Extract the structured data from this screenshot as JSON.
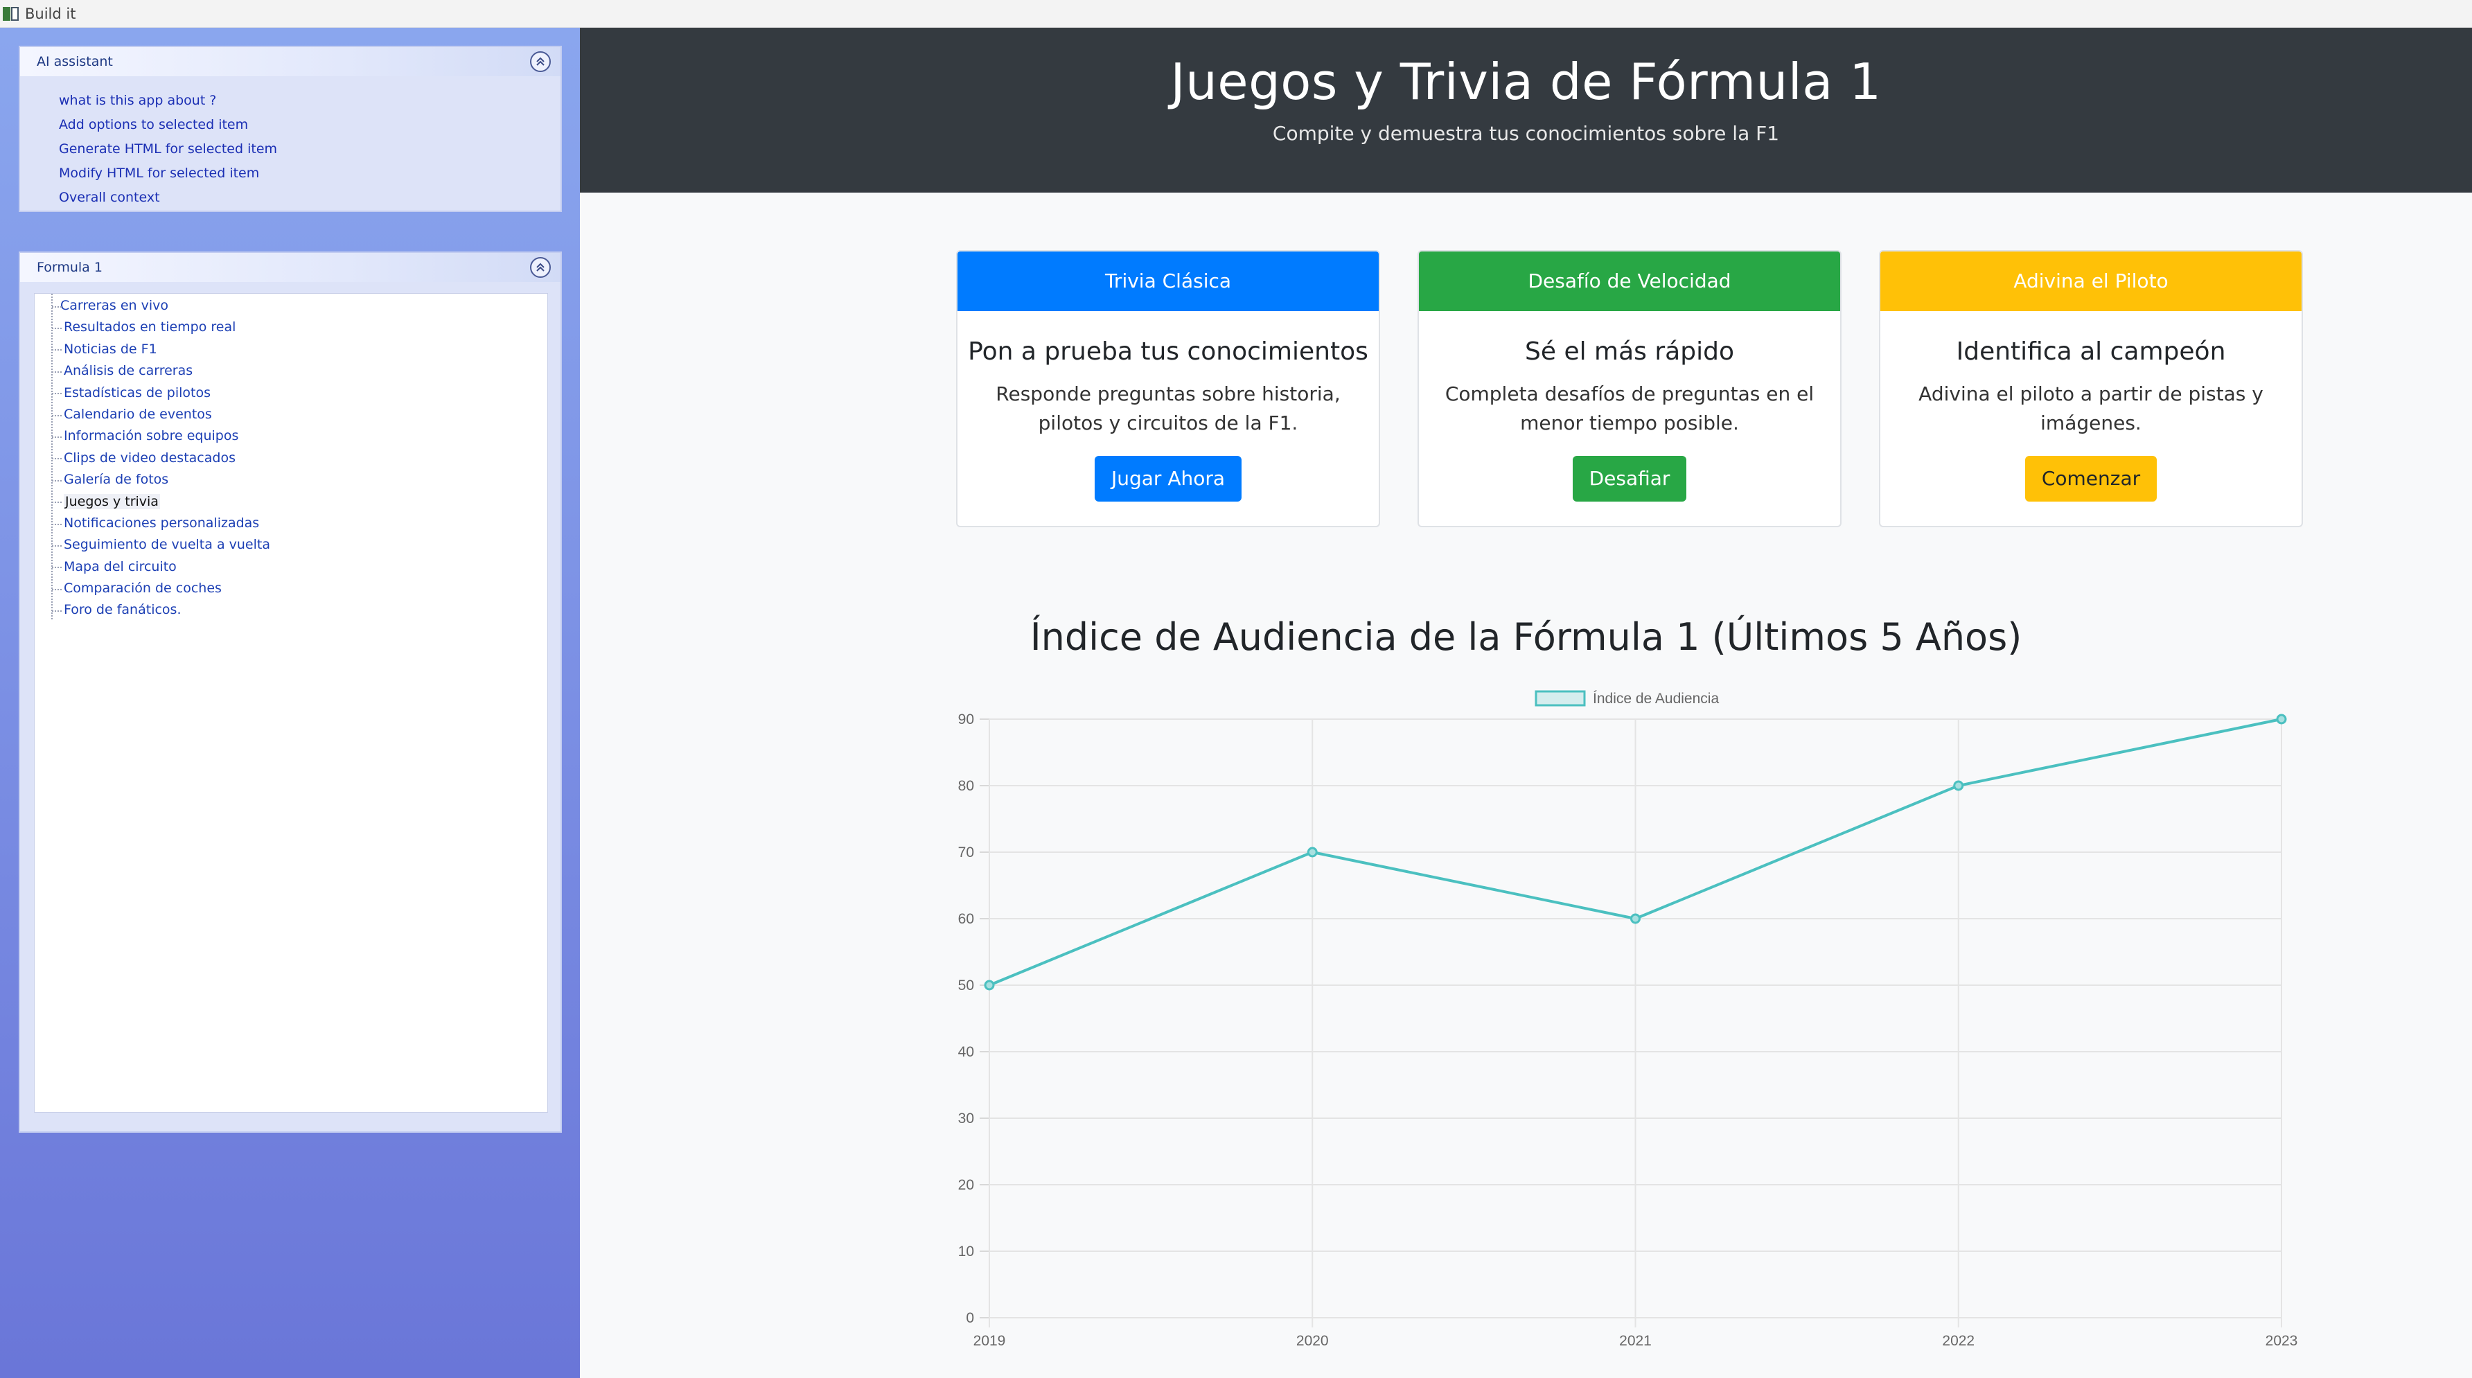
{
  "window": {
    "title": "Build it"
  },
  "ai_panel": {
    "title": "AI assistant",
    "items": [
      "what is this app about ?",
      "Add options to selected item",
      "Generate HTML for selected item",
      "Modify HTML for selected item",
      "Overall context"
    ]
  },
  "nav_panel": {
    "title": "Formula 1",
    "items": [
      "Carreras en vivo",
      "Resultados en tiempo real",
      "Noticias de F1",
      "Análisis de carreras",
      "Estadísticas de pilotos",
      "Calendario de eventos",
      "Información sobre equipos",
      "Clips de video destacados",
      "Galería de fotos",
      "Juegos y trivia",
      "Notificaciones personalizadas",
      "Seguimiento de vuelta a vuelta",
      "Mapa del circuito",
      "Comparación de coches",
      "Foro de fanáticos."
    ],
    "selected": "Juegos y trivia"
  },
  "hero": {
    "title": "Juegos y Trivia de Fórmula 1",
    "subtitle": "Compite y demuestra tus conocimientos sobre la F1"
  },
  "cards": [
    {
      "header": "Trivia Clásica",
      "title": "Pon a prueba tus conocimientos",
      "text": "Responde preguntas sobre historia, pilotos y circuitos de la F1.",
      "button": "Jugar Ahora",
      "color": "#007bff",
      "header_text_color": "#ffffff",
      "button_text_color": "#ffffff"
    },
    {
      "header": "Desafío de Velocidad",
      "title": "Sé el más rápido",
      "text": "Completa desafíos de preguntas en el menor tiempo posible.",
      "button": "Desafiar",
      "color": "#28a745",
      "header_text_color": "#ffffff",
      "button_text_color": "#ffffff"
    },
    {
      "header": "Adivina el Piloto",
      "title": "Identifica al campeón",
      "text": "Adivina el piloto a partir de pistas y imágenes.",
      "button": "Comenzar",
      "color": "#ffc107",
      "header_text_color": "#ffffff",
      "button_text_color": "#212529"
    }
  ],
  "chart_data": {
    "type": "line",
    "title": "Índice de Audiencia de la Fórmula 1 (Últimos 5 Años)",
    "x": [
      "2019",
      "2020",
      "2021",
      "2022",
      "2023"
    ],
    "series": [
      {
        "name": "Índice de Audiencia",
        "values": [
          50,
          70,
          60,
          80,
          90
        ],
        "color": "#4bc0c0"
      }
    ],
    "ylim": [
      0,
      90
    ],
    "yticks": [
      0,
      10,
      20,
      30,
      40,
      50,
      60,
      70,
      80,
      90
    ],
    "grid": true,
    "legend": "top-center"
  }
}
